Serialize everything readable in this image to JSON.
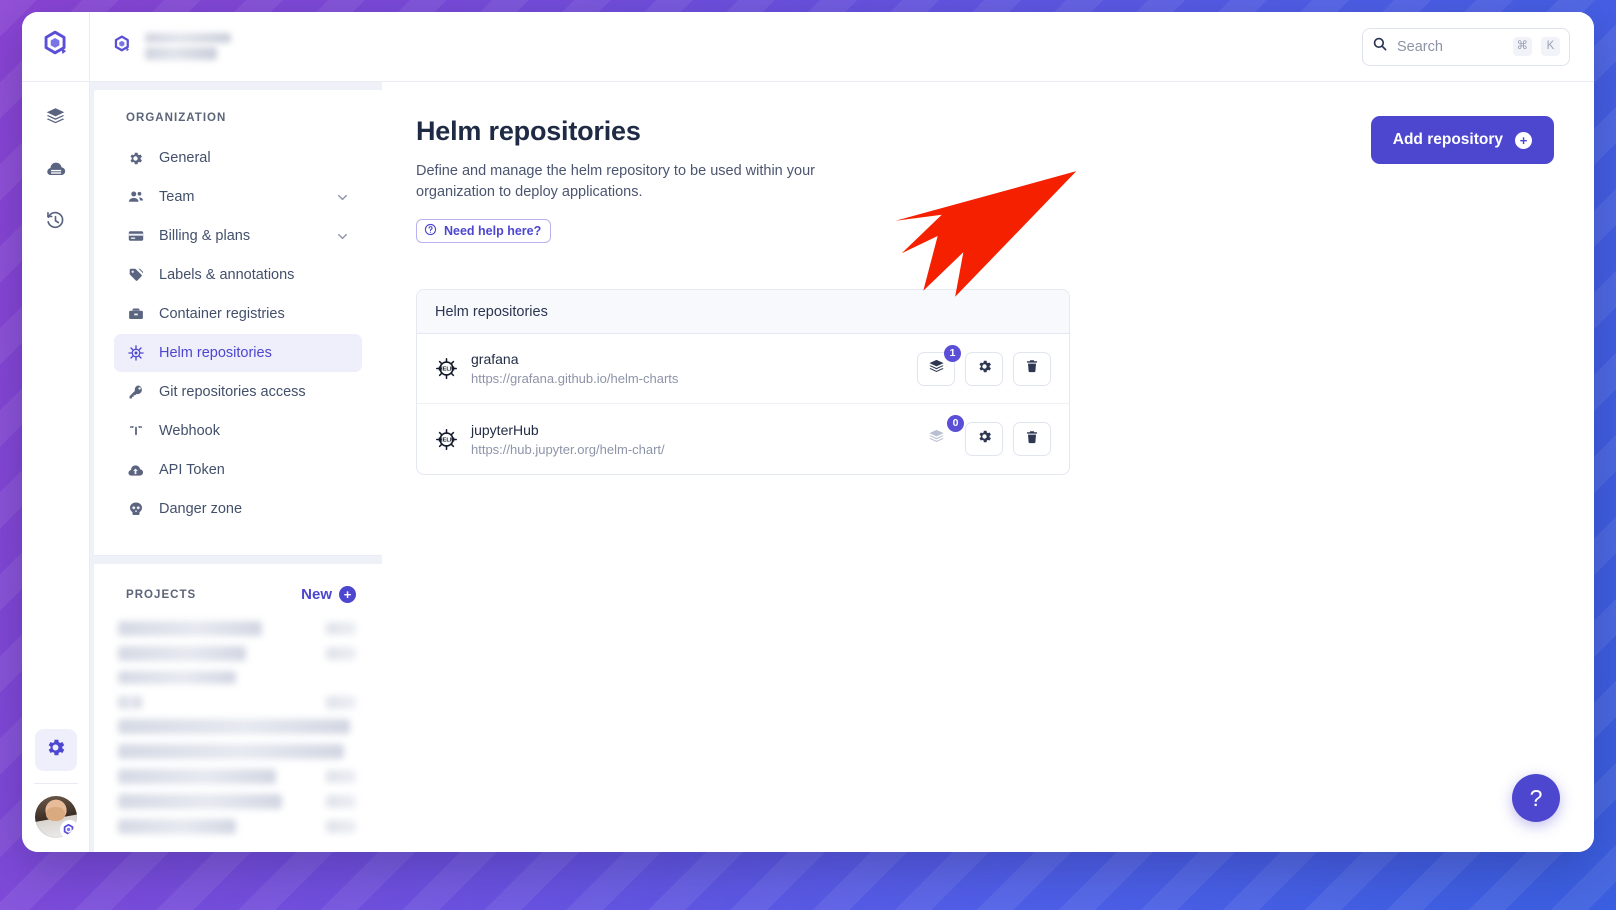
{
  "window": {
    "logo_icon": "qovery-hexagon-logo",
    "org_logo_icon": "qovery-hexagon-small",
    "org_name_redacted": true
  },
  "search": {
    "placeholder": "Search",
    "icon": "search-icon",
    "shortcut_modifier": "⌘",
    "shortcut_key": "K"
  },
  "icon_rail": {
    "items": [
      {
        "name": "environments",
        "icon": "layers-stack-icon",
        "active": false
      },
      {
        "name": "clusters",
        "icon": "cloud-server-icon",
        "active": false
      },
      {
        "name": "activity",
        "icon": "clock-history-icon",
        "active": false
      }
    ],
    "bottom": [
      {
        "name": "settings",
        "icon": "gear-icon",
        "active": true
      },
      {
        "name": "user-avatar",
        "icon": "avatar",
        "badge_icon": "qovery-hexagon-small"
      }
    ]
  },
  "sidebar": {
    "organization_label": "ORGANIZATION",
    "items": [
      {
        "label": "General",
        "icon": "gear-icon",
        "expandable": false,
        "selected": false
      },
      {
        "label": "Team",
        "icon": "users-icon",
        "expandable": true,
        "selected": false
      },
      {
        "label": "Billing & plans",
        "icon": "credit-card-icon",
        "expandable": true,
        "selected": false
      },
      {
        "label": "Labels & annotations",
        "icon": "tag-icon",
        "expandable": false,
        "selected": false
      },
      {
        "label": "Container registries",
        "icon": "briefcase-icon",
        "expandable": false,
        "selected": false
      },
      {
        "label": "Helm repositories",
        "icon": "helm-wheel-icon",
        "expandable": false,
        "selected": true
      },
      {
        "label": "Git repositories access",
        "icon": "key-icon",
        "expandable": false,
        "selected": false
      },
      {
        "label": "Webhook",
        "icon": "webhook-icon",
        "expandable": false,
        "selected": false
      },
      {
        "label": "API Token",
        "icon": "cloud-upload-icon",
        "expandable": false,
        "selected": false
      },
      {
        "label": "Danger zone",
        "icon": "skull-icon",
        "expandable": false,
        "selected": false
      }
    ],
    "projects_label": "PROJECTS",
    "new_project_label": "New",
    "new_project_icon": "plus-circle-icon",
    "project_rows_redacted": 9
  },
  "main": {
    "title": "Helm repositories",
    "description": "Define and manage the helm repository to be used within your organization to deploy applications.",
    "help_badge": {
      "label": "Need help here?",
      "icon": "question-circle-icon"
    },
    "add_button": {
      "label": "Add repository",
      "icon": "plus-circle-icon"
    },
    "card": {
      "header": "Helm repositories",
      "rows": [
        {
          "logo_icon": "helm-wheel-icon",
          "name": "grafana",
          "url": "https://grafana.github.io/helm-charts",
          "services_count": "1",
          "services_icon": "layers-stack-icon",
          "services_enabled": true,
          "settings_icon": "gear-icon",
          "delete_icon": "trash-icon"
        },
        {
          "logo_icon": "helm-wheel-icon",
          "name": "jupyterHub",
          "url": "https://hub.jupyter.org/helm-chart/",
          "services_count": "0",
          "services_icon": "layers-stack-icon",
          "services_enabled": false,
          "settings_icon": "gear-icon",
          "delete_icon": "trash-icon"
        }
      ]
    },
    "help_fab": {
      "label": "?",
      "icon": "question-mark-icon"
    },
    "annotation": {
      "type": "red-arrow",
      "color": "#f42000",
      "points_to": "grafana-row-services-button"
    }
  },
  "colors": {
    "accent": "#4d46cf",
    "badge": "#5a4fd6",
    "annotation_red": "#f42000",
    "page_bg": "#ffffff",
    "panel_bg": "#eef1f8",
    "desktop_gradient_from": "#8b44d4",
    "desktop_gradient_to": "#3a5fe0"
  }
}
